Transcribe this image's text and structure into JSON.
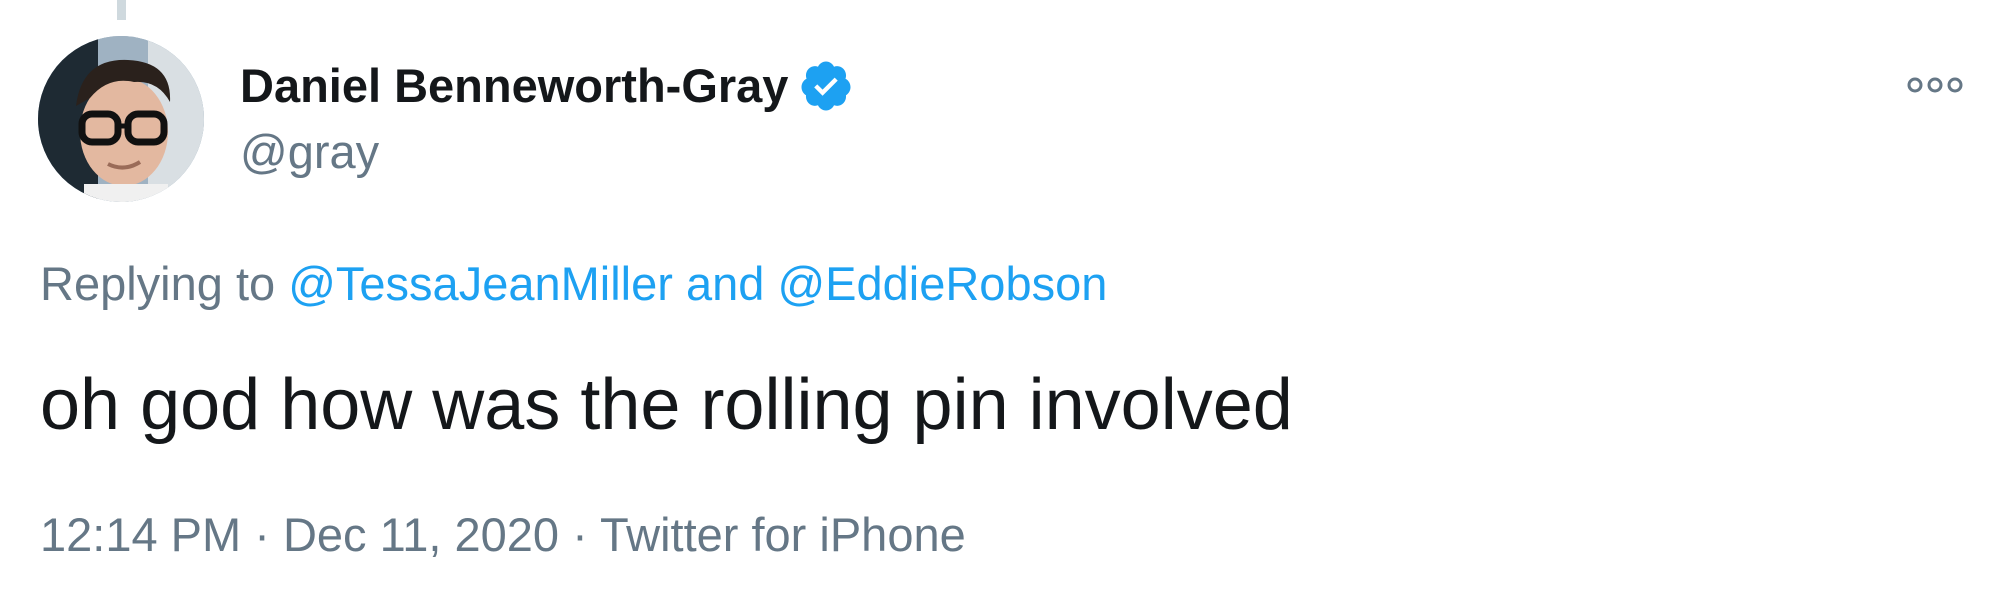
{
  "tweet": {
    "author": {
      "display_name": "Daniel Benneworth-Gray",
      "handle": "@gray",
      "verified": true,
      "avatar_icon": "user-avatar"
    },
    "reply": {
      "prefix": "Replying to",
      "mention_1": "@TessaJeanMiller",
      "conjunction": "and",
      "mention_2": "@EddieRobson"
    },
    "text": "oh god how was the rolling pin involved",
    "meta": {
      "time": "12:14 PM",
      "separator": "·",
      "date": "Dec 11, 2020",
      "source": "Twitter for iPhone"
    },
    "more_icon": "more-options-icon"
  },
  "colors": {
    "text": "#14171a",
    "secondary": "#657786",
    "link": "#1da1f2",
    "badge": "#1da1f2",
    "thread_line": "#cfd9de"
  }
}
